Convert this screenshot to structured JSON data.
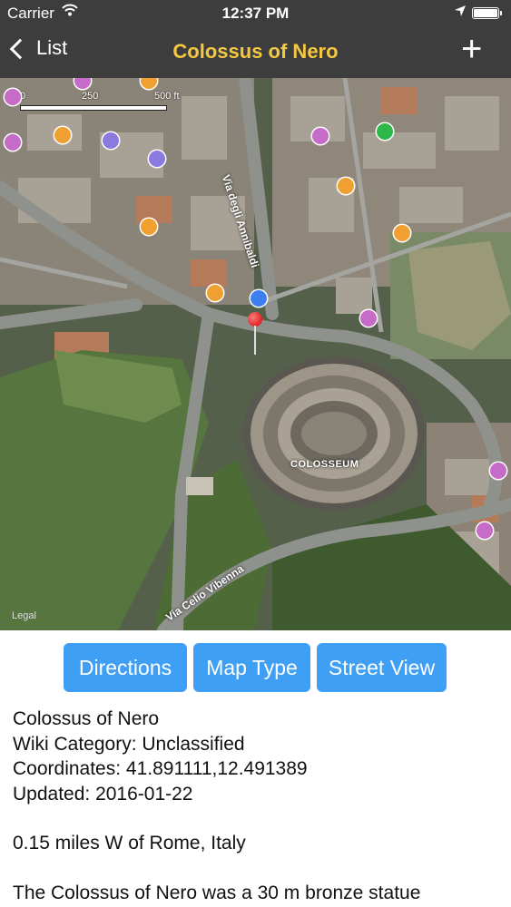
{
  "status_bar": {
    "carrier": "Carrier",
    "time": "12:37 PM"
  },
  "nav": {
    "back_label": "List",
    "title": "Colossus of Nero"
  },
  "map": {
    "scale": {
      "tick0": "0",
      "tick1": "250",
      "tick2": "500 ft"
    },
    "legal": "Legal",
    "landmark_label": "COLOSSEUM",
    "streets": {
      "street1": "Via degli Annibaldi",
      "street2": "Via Celio Vibenna"
    }
  },
  "buttons": {
    "directions": "Directions",
    "map_type": "Map Type",
    "street_view": "Street View"
  },
  "info": {
    "name": "Colossus of Nero",
    "category": "Wiki Category: Unclassified",
    "coordinates": "Coordinates: 41.891111,12.491389",
    "updated": "Updated: 2016-01-22",
    "distance": "0.15 miles W of Rome, Italy",
    "description": "The Colossus of Nero was a 30 m bronze statue"
  },
  "colors": {
    "nav_bg": "#3d3d3d",
    "title": "#f5c842",
    "button": "#3e9ff5",
    "pin": "#e00000"
  }
}
